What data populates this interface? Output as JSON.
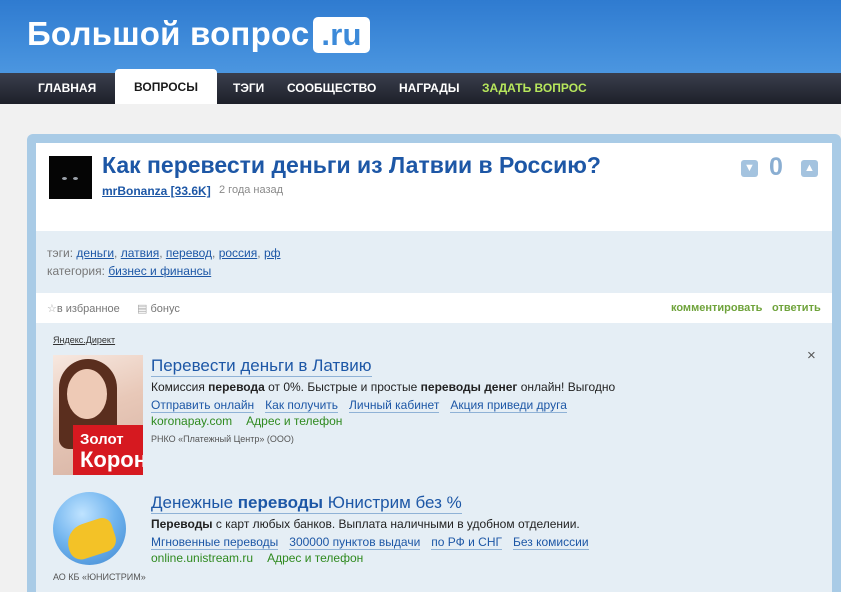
{
  "header": {
    "logo_main": "Большой вопрос",
    "logo_ru": ".ru"
  },
  "nav": {
    "items": [
      {
        "label": "ГЛАВНАЯ"
      },
      {
        "label": "ВОПРОСЫ",
        "active": true
      },
      {
        "label": "ТЭГИ"
      },
      {
        "label": "СООБЩЕСТВО"
      },
      {
        "label": "НАГРАДЫ"
      },
      {
        "label": "ЗАДАТЬ ВОПРОС"
      }
    ]
  },
  "question": {
    "title": "Как перевести деньги из Латвии в Россию?",
    "author": "mrBonanza [33.6K]",
    "time": "2 года назад",
    "votes": "0",
    "vote_down_icon": "thumbs-down-icon",
    "vote_up_icon": "thumbs-up-icon"
  },
  "meta": {
    "tags_label": "тэги:",
    "tags": [
      "деньги",
      "латвия",
      "перевод",
      "россия",
      "рф"
    ],
    "category_label": "категория:",
    "category": "бизнес и финансы"
  },
  "actions": {
    "favorite": "в избранное",
    "bonus": "бонус",
    "comment": "комментировать",
    "answer": "ответить"
  },
  "ads": {
    "source": "Яндекс.Директ",
    "close": "×",
    "items": [
      {
        "title_parts": [
          "Перевести деньги",
          " в ",
          "Латвию"
        ],
        "text_parts": [
          "Комиссия ",
          "перевода",
          " от 0%. Быстрые и простые ",
          "переводы денег",
          " онлайн! Выгодно"
        ],
        "links": [
          "Отправить онлайн",
          "Как получить",
          "Личный кабинет",
          "Акция приведи друга"
        ],
        "url": "koronapay.com",
        "address": "Адрес и телефон",
        "legal": "РНКО «Платежный Центр» (ООО)",
        "image_text": [
          "Золот",
          "Корон"
        ]
      },
      {
        "title_parts": [
          "Денежные ",
          "переводы",
          " Юнистрим без %"
        ],
        "text_parts": [
          "Переводы",
          " с карт любых банков. Выплата наличными в удобном отделении."
        ],
        "links": [
          "Мгновенные переводы",
          "300000 пунктов выдачи",
          "по РФ и СНГ",
          "Без комиссии"
        ],
        "url": "online.unistream.ru",
        "address": "Адрес и телефон",
        "legal": "АО КБ «ЮНИСТРИМ»"
      }
    ]
  }
}
